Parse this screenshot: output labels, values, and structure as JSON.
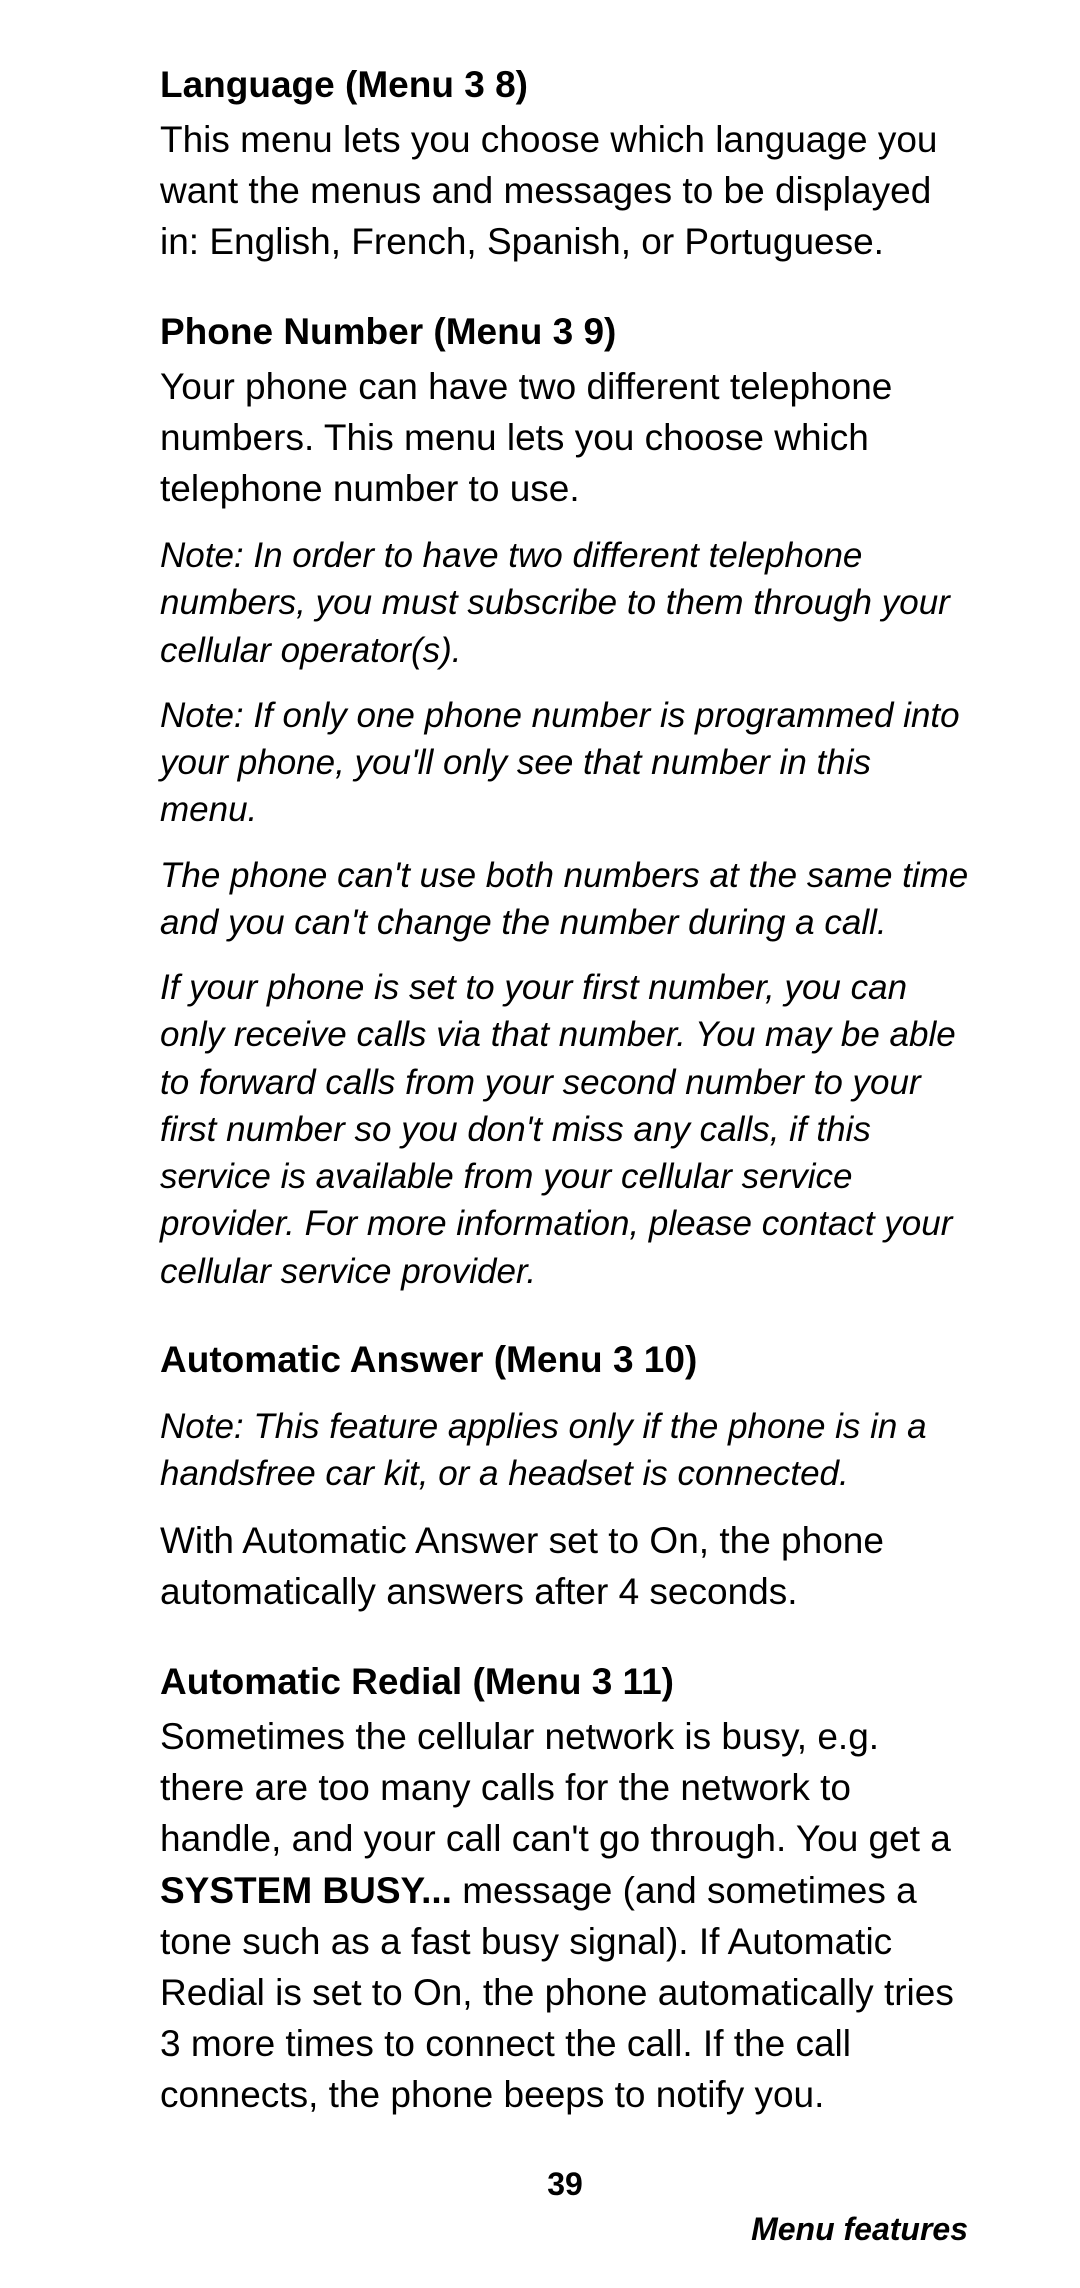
{
  "sections": [
    {
      "heading": "Language (Menu 3 8)",
      "body": "This menu lets you choose which language you want the menus and messages to be displayed in: English, French, Spanish, or Portuguese."
    },
    {
      "heading": "Phone Number (Menu 3 9)",
      "body": "Your phone can have two different telephone numbers. This menu lets you choose which telephone number to use.",
      "notes": [
        "Note: In order to have two different telephone numbers, you must subscribe to them through your cellular operator(s).",
        "Note: If only one phone number is programmed into your phone, you'll only see that number in this menu.",
        "The phone can't use both numbers at the same time and you can't change the number during a call.",
        "If your phone is set to your first number, you can only receive calls via that number. You may be able to forward calls from your second number to your first number so you don't miss any calls, if this service is available from your cellular service provider. For more information, please contact your cellular service provider."
      ]
    },
    {
      "heading": "Automatic Answer (Menu 3 10)",
      "notes": [
        "Note: This feature applies only if the phone is in a handsfree car kit, or a headset is connected."
      ],
      "body_after": "With Automatic Answer set to On, the phone automatically answers after 4 seconds."
    },
    {
      "heading": "Automatic Redial (Menu 3 11)",
      "redial": {
        "pre": "Sometimes the cellular network is busy, e.g. there are too many calls for the network to handle, and your call can't go through. You get a ",
        "bold": "SYSTEM BUSY...",
        "post": " message (and sometimes a tone such as a fast busy signal). If Automatic Redial is set to On, the phone automatically tries 3 more times to connect the call. If the call connects, the phone beeps to notify you."
      }
    }
  ],
  "page_number": "39",
  "footer": "Menu features"
}
